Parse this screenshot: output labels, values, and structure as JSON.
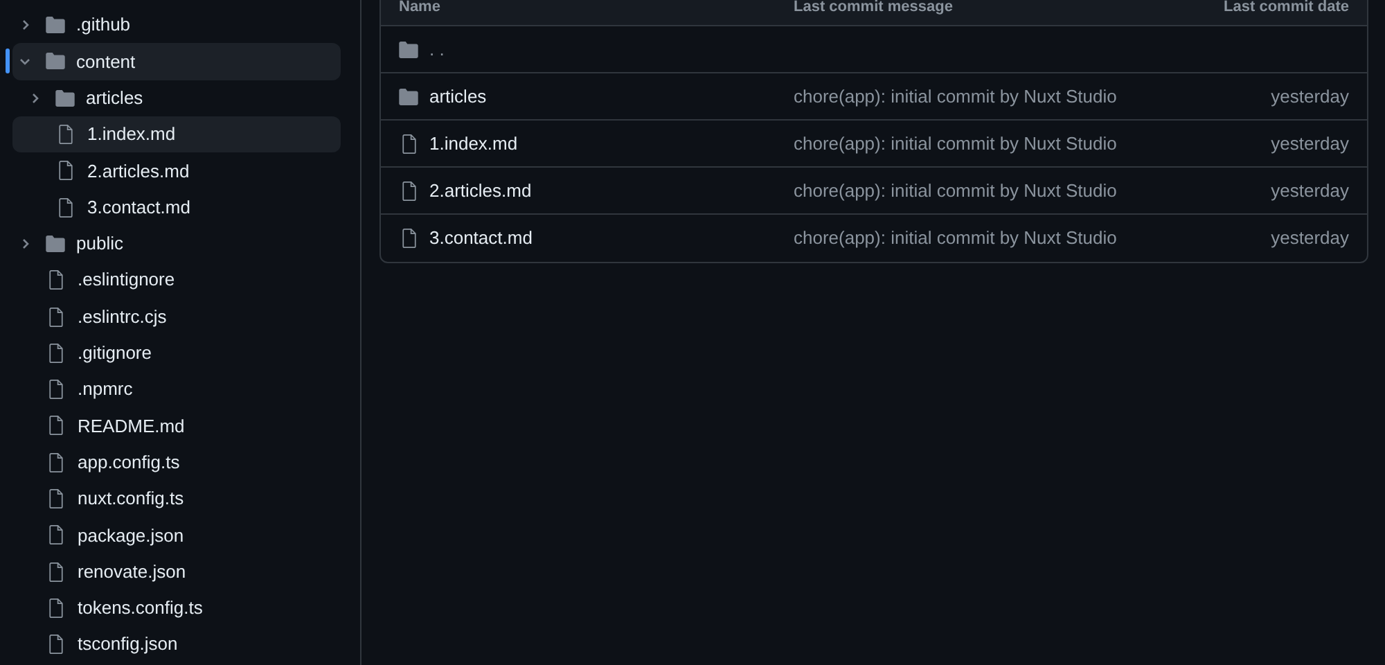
{
  "sidebar": {
    "tree": [
      {
        "kind": "folder",
        "name": ".github",
        "expanded": false,
        "active": false
      },
      {
        "kind": "folder",
        "name": "content",
        "expanded": true,
        "active": true,
        "children": [
          {
            "kind": "folder",
            "name": "articles",
            "expanded": false,
            "active": false
          },
          {
            "kind": "file",
            "name": "1.index.md",
            "selected": true
          },
          {
            "kind": "file",
            "name": "2.articles.md",
            "selected": false
          },
          {
            "kind": "file",
            "name": "3.contact.md",
            "selected": false
          }
        ]
      },
      {
        "kind": "folder",
        "name": "public",
        "expanded": false,
        "active": false
      },
      {
        "kind": "file",
        "name": ".eslintignore",
        "selected": false
      },
      {
        "kind": "file",
        "name": ".eslintrc.cjs",
        "selected": false
      },
      {
        "kind": "file",
        "name": ".gitignore",
        "selected": false
      },
      {
        "kind": "file",
        "name": ".npmrc",
        "selected": false
      },
      {
        "kind": "file",
        "name": "README.md",
        "selected": false
      },
      {
        "kind": "file",
        "name": "app.config.ts",
        "selected": false
      },
      {
        "kind": "file",
        "name": "nuxt.config.ts",
        "selected": false
      },
      {
        "kind": "file",
        "name": "package.json",
        "selected": false
      },
      {
        "kind": "file",
        "name": "renovate.json",
        "selected": false
      },
      {
        "kind": "file",
        "name": "tokens.config.ts",
        "selected": false
      },
      {
        "kind": "file",
        "name": "tsconfig.json",
        "selected": false
      }
    ]
  },
  "table": {
    "columns": [
      "Name",
      "Last commit message",
      "Last commit date"
    ],
    "parent_row": {
      "kind": "folder",
      "name": ". ."
    },
    "rows": [
      {
        "kind": "folder",
        "name": "articles",
        "message": "chore(app): initial commit by Nuxt Studio",
        "date": "yesterday"
      },
      {
        "kind": "file",
        "name": "1.index.md",
        "message": "chore(app): initial commit by Nuxt Studio",
        "date": "yesterday"
      },
      {
        "kind": "file",
        "name": "2.articles.md",
        "message": "chore(app): initial commit by Nuxt Studio",
        "date": "yesterday"
      },
      {
        "kind": "file",
        "name": "3.contact.md",
        "message": "chore(app): initial commit by Nuxt Studio",
        "date": "yesterday"
      }
    ]
  }
}
